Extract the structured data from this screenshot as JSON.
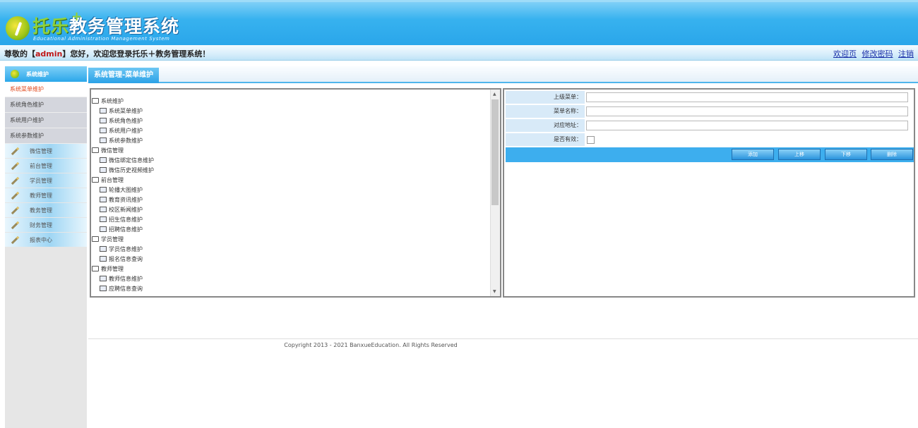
{
  "header": {
    "logo_brand": "托乐",
    "logo_plus": "+",
    "logo_title": "教务管理系统",
    "logo_subtitle": "Educational Administration Management System"
  },
  "welcome": {
    "prefix": "尊敬的【",
    "user": "admin",
    "suffix": "】您好，欢迎您登录托乐＋教务管理系统！",
    "links": [
      "欢迎页",
      "修改密码",
      "注销"
    ]
  },
  "sidebar": {
    "header": "系统维护",
    "sub_items": [
      "系统菜单维护",
      "系统角色维护",
      "系统用户维护",
      "系统参数维护"
    ],
    "menus": [
      "微信管理",
      "前台管理",
      "学员管理",
      "教师管理",
      "教务管理",
      "财务管理",
      "报表中心"
    ]
  },
  "tab": {
    "title": "系统管理-菜单维护"
  },
  "tree": [
    {
      "label": "系统维护",
      "level": 0
    },
    {
      "label": "系统菜单维护",
      "level": 1
    },
    {
      "label": "系统角色维护",
      "level": 1
    },
    {
      "label": "系统用户维护",
      "level": 1
    },
    {
      "label": "系统参数维护",
      "level": 1
    },
    {
      "label": "微信管理",
      "level": 0
    },
    {
      "label": "微信绑定信息维护",
      "level": 1
    },
    {
      "label": "微信历史视频维护",
      "level": 1
    },
    {
      "label": "前台管理",
      "level": 0
    },
    {
      "label": "轮播大图维护",
      "level": 1
    },
    {
      "label": "教育资讯维护",
      "level": 1
    },
    {
      "label": "校区新闻维护",
      "level": 1
    },
    {
      "label": "招生信息维护",
      "level": 1
    },
    {
      "label": "招聘信息维护",
      "level": 1
    },
    {
      "label": "学员管理",
      "level": 0
    },
    {
      "label": "学员信息维护",
      "level": 1
    },
    {
      "label": "报名信息查询",
      "level": 1
    },
    {
      "label": "教师管理",
      "level": 0
    },
    {
      "label": "教师信息维护",
      "level": 1
    },
    {
      "label": "应聘信息查询",
      "level": 1
    }
  ],
  "form": {
    "parent_label": "上级菜单：",
    "parent_value": "",
    "name_label": "菜单名称：",
    "name_value": "",
    "url_label": "对应地址：",
    "url_value": "",
    "valid_label": "是否有效："
  },
  "buttons": [
    "添加",
    "上移",
    "下移",
    "删除"
  ],
  "footer": {
    "copyright": "Copyright 2013 - 2021 BanxueEducation. All Rights Reserved"
  },
  "colors": {
    "accent": "#2ba7ea",
    "active_link": "#e0471a",
    "username": "#c01818"
  }
}
